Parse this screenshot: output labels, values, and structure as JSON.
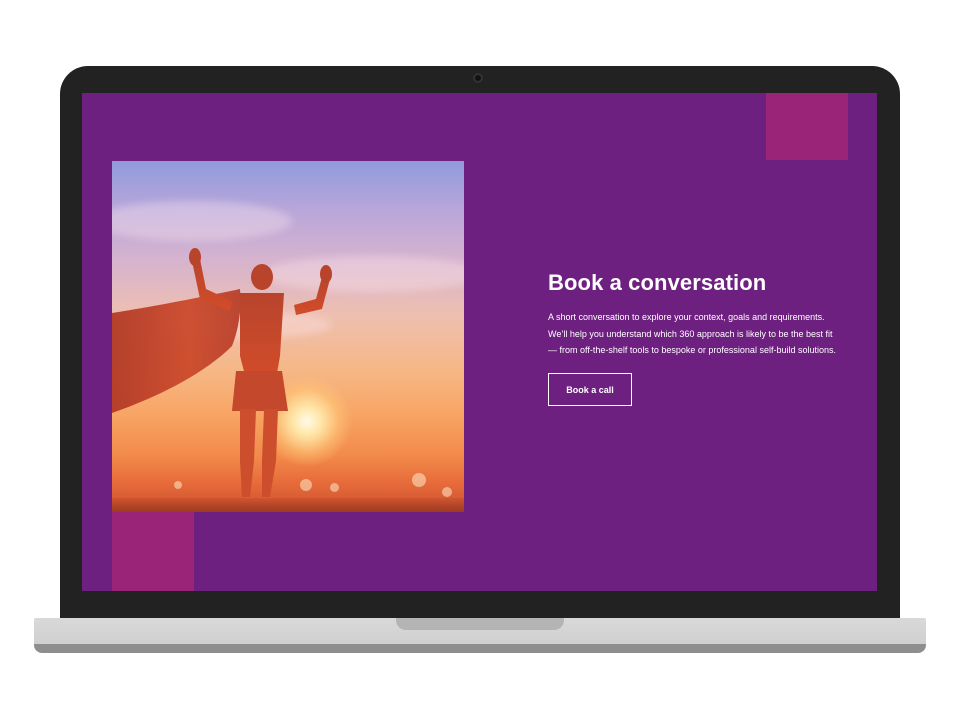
{
  "hero": {
    "title": "Book a conversation",
    "description_lines": [
      "A short conversation to explore your context, goals and requirements.",
      "We’ll help you understand which 360 approach is likely to be the best fit",
      "— from off-the-shelf tools to bespoke or professional self-build solutions."
    ],
    "cta_label": "Book a call",
    "image_subject": "woman-with-cape-silhouette-at-sunset"
  },
  "colors": {
    "screen_background": "#6e2081",
    "accent_square": "#9a2478",
    "text": "#ffffff",
    "laptop_bezel": "#222222",
    "laptop_base": "#d9d9d9"
  }
}
